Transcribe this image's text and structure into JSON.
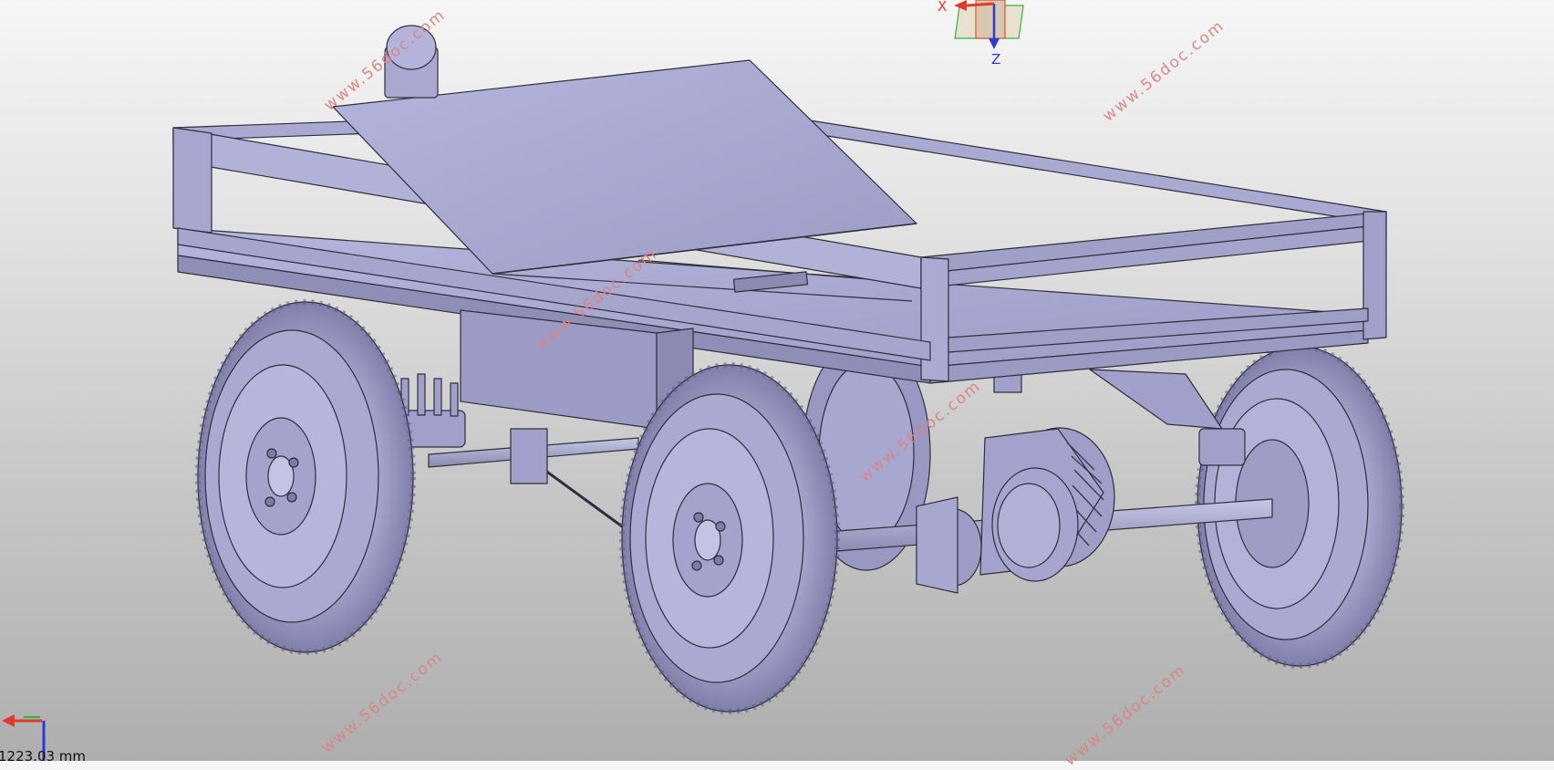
{
  "viewport": {
    "compass": {
      "x_label": "X",
      "z_label": "Z"
    },
    "scale": {
      "label": "1223.03 mm"
    },
    "watermarks": [
      "www.56doc.com",
      "www.56doc.com",
      "www.56doc.com",
      "www.56doc.com",
      "www.56doc.com",
      "www.56doc.com"
    ],
    "model": {
      "name": "trailer-cart-assembly"
    }
  },
  "colors": {
    "part_fill": "#a9a9cf",
    "part_light": "#bdbddf",
    "part_dark": "#8c8cb4",
    "edge": "#2e2e3c",
    "axis_x": "#e23a2a",
    "axis_y": "#2bb83a",
    "axis_z": "#2a3ad8",
    "watermark": "#d98484"
  }
}
